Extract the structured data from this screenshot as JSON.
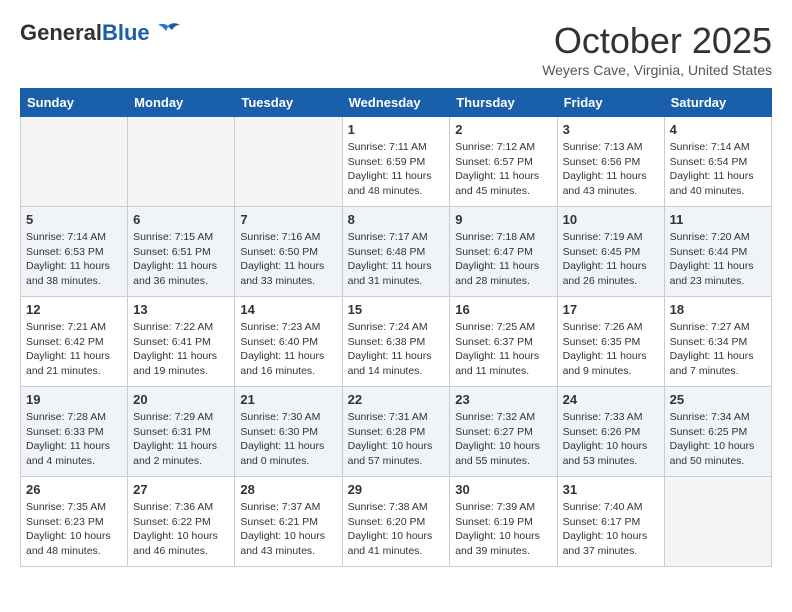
{
  "header": {
    "logo": {
      "general": "General",
      "blue": "Blue"
    },
    "title": "October 2025",
    "location": "Weyers Cave, Virginia, United States"
  },
  "weekdays": [
    "Sunday",
    "Monday",
    "Tuesday",
    "Wednesday",
    "Thursday",
    "Friday",
    "Saturday"
  ],
  "weeks": [
    [
      {
        "day": "",
        "empty": true
      },
      {
        "day": "",
        "empty": true
      },
      {
        "day": "",
        "empty": true
      },
      {
        "day": "1",
        "sunrise": "7:11 AM",
        "sunset": "6:59 PM",
        "daylight": "11 hours and 48 minutes."
      },
      {
        "day": "2",
        "sunrise": "7:12 AM",
        "sunset": "6:57 PM",
        "daylight": "11 hours and 45 minutes."
      },
      {
        "day": "3",
        "sunrise": "7:13 AM",
        "sunset": "6:56 PM",
        "daylight": "11 hours and 43 minutes."
      },
      {
        "day": "4",
        "sunrise": "7:14 AM",
        "sunset": "6:54 PM",
        "daylight": "11 hours and 40 minutes."
      }
    ],
    [
      {
        "day": "5",
        "sunrise": "7:14 AM",
        "sunset": "6:53 PM",
        "daylight": "11 hours and 38 minutes."
      },
      {
        "day": "6",
        "sunrise": "7:15 AM",
        "sunset": "6:51 PM",
        "daylight": "11 hours and 36 minutes."
      },
      {
        "day": "7",
        "sunrise": "7:16 AM",
        "sunset": "6:50 PM",
        "daylight": "11 hours and 33 minutes."
      },
      {
        "day": "8",
        "sunrise": "7:17 AM",
        "sunset": "6:48 PM",
        "daylight": "11 hours and 31 minutes."
      },
      {
        "day": "9",
        "sunrise": "7:18 AM",
        "sunset": "6:47 PM",
        "daylight": "11 hours and 28 minutes."
      },
      {
        "day": "10",
        "sunrise": "7:19 AM",
        "sunset": "6:45 PM",
        "daylight": "11 hours and 26 minutes."
      },
      {
        "day": "11",
        "sunrise": "7:20 AM",
        "sunset": "6:44 PM",
        "daylight": "11 hours and 23 minutes."
      }
    ],
    [
      {
        "day": "12",
        "sunrise": "7:21 AM",
        "sunset": "6:42 PM",
        "daylight": "11 hours and 21 minutes."
      },
      {
        "day": "13",
        "sunrise": "7:22 AM",
        "sunset": "6:41 PM",
        "daylight": "11 hours and 19 minutes."
      },
      {
        "day": "14",
        "sunrise": "7:23 AM",
        "sunset": "6:40 PM",
        "daylight": "11 hours and 16 minutes."
      },
      {
        "day": "15",
        "sunrise": "7:24 AM",
        "sunset": "6:38 PM",
        "daylight": "11 hours and 14 minutes."
      },
      {
        "day": "16",
        "sunrise": "7:25 AM",
        "sunset": "6:37 PM",
        "daylight": "11 hours and 11 minutes."
      },
      {
        "day": "17",
        "sunrise": "7:26 AM",
        "sunset": "6:35 PM",
        "daylight": "11 hours and 9 minutes."
      },
      {
        "day": "18",
        "sunrise": "7:27 AM",
        "sunset": "6:34 PM",
        "daylight": "11 hours and 7 minutes."
      }
    ],
    [
      {
        "day": "19",
        "sunrise": "7:28 AM",
        "sunset": "6:33 PM",
        "daylight": "11 hours and 4 minutes."
      },
      {
        "day": "20",
        "sunrise": "7:29 AM",
        "sunset": "6:31 PM",
        "daylight": "11 hours and 2 minutes."
      },
      {
        "day": "21",
        "sunrise": "7:30 AM",
        "sunset": "6:30 PM",
        "daylight": "11 hours and 0 minutes."
      },
      {
        "day": "22",
        "sunrise": "7:31 AM",
        "sunset": "6:28 PM",
        "daylight": "10 hours and 57 minutes."
      },
      {
        "day": "23",
        "sunrise": "7:32 AM",
        "sunset": "6:27 PM",
        "daylight": "10 hours and 55 minutes."
      },
      {
        "day": "24",
        "sunrise": "7:33 AM",
        "sunset": "6:26 PM",
        "daylight": "10 hours and 53 minutes."
      },
      {
        "day": "25",
        "sunrise": "7:34 AM",
        "sunset": "6:25 PM",
        "daylight": "10 hours and 50 minutes."
      }
    ],
    [
      {
        "day": "26",
        "sunrise": "7:35 AM",
        "sunset": "6:23 PM",
        "daylight": "10 hours and 48 minutes."
      },
      {
        "day": "27",
        "sunrise": "7:36 AM",
        "sunset": "6:22 PM",
        "daylight": "10 hours and 46 minutes."
      },
      {
        "day": "28",
        "sunrise": "7:37 AM",
        "sunset": "6:21 PM",
        "daylight": "10 hours and 43 minutes."
      },
      {
        "day": "29",
        "sunrise": "7:38 AM",
        "sunset": "6:20 PM",
        "daylight": "10 hours and 41 minutes."
      },
      {
        "day": "30",
        "sunrise": "7:39 AM",
        "sunset": "6:19 PM",
        "daylight": "10 hours and 39 minutes."
      },
      {
        "day": "31",
        "sunrise": "7:40 AM",
        "sunset": "6:17 PM",
        "daylight": "10 hours and 37 minutes."
      },
      {
        "day": "",
        "empty": true
      }
    ]
  ]
}
